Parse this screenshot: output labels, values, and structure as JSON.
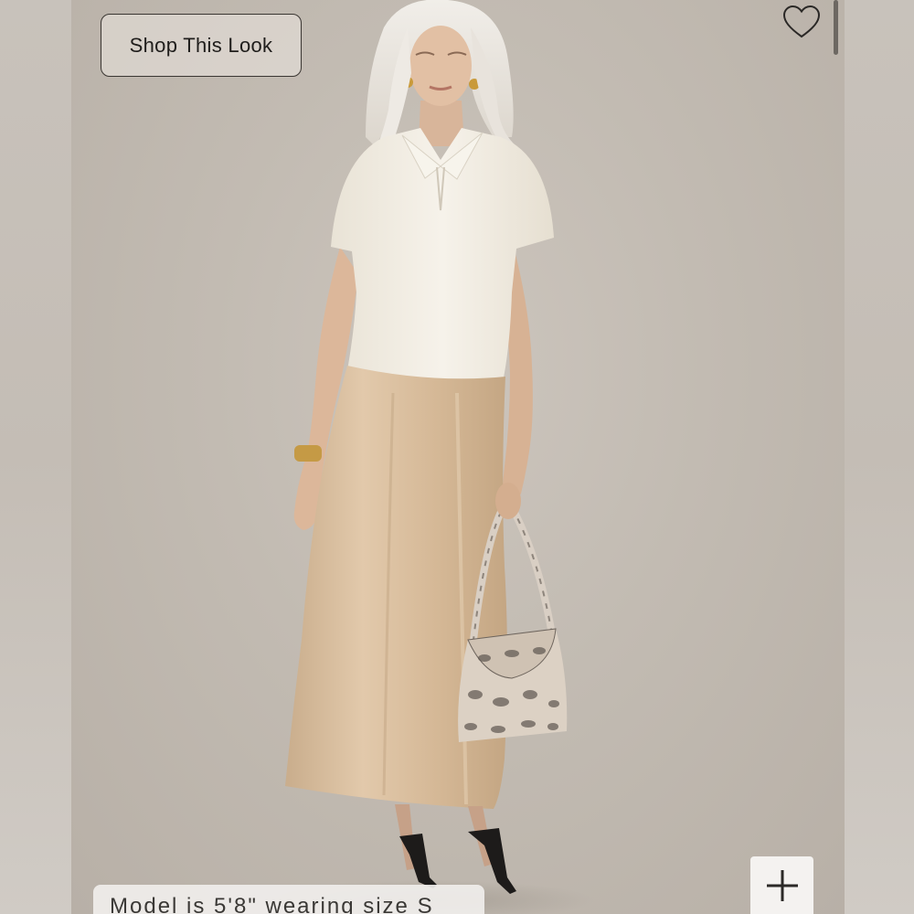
{
  "shop_button": {
    "label": "Shop This Look"
  },
  "favorite": {
    "icon": "heart-outline-icon"
  },
  "expand": {
    "icon": "plus-icon"
  },
  "caption": {
    "text": "Model is 5'8\" wearing size S"
  },
  "photo": {
    "icon": "model-photo",
    "colors": {
      "background": "#c2bbb2",
      "top": "#f3efe6",
      "skirt": "#d6bc9e",
      "hair": "#ece8e2",
      "bag": "#d8cdc0"
    }
  }
}
